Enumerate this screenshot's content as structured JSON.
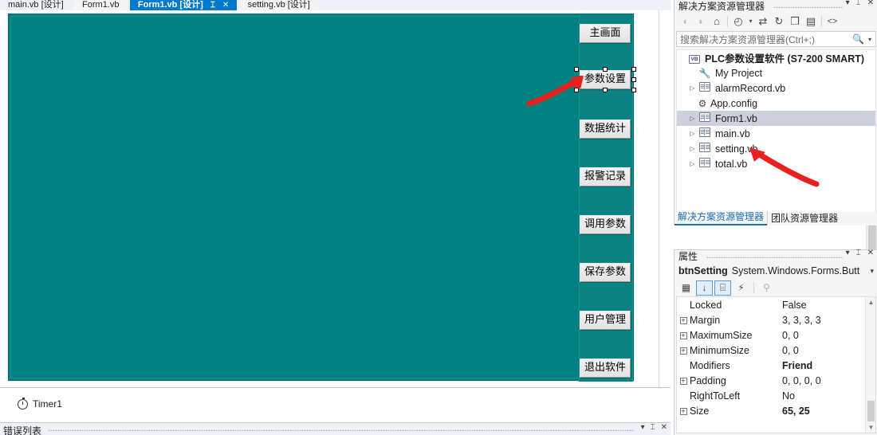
{
  "editor_tabs": [
    {
      "label": "main.vb [设计]",
      "state": "inactive"
    },
    {
      "label": "Form1.vb",
      "state": "inactive"
    },
    {
      "label": "Form1.vb [设计]",
      "state": "active"
    },
    {
      "label": "setting.vb [设计]",
      "state": "inactive"
    }
  ],
  "designer": {
    "form_background": "#008080",
    "panel_background": "#0b8382",
    "buttons": [
      {
        "label": "主画面",
        "selected": false
      },
      {
        "label": "参数设置",
        "selected": true
      },
      {
        "label": "数据统计",
        "selected": false
      },
      {
        "label": "报警记录",
        "selected": false
      },
      {
        "label": "调用参数",
        "selected": false
      },
      {
        "label": "保存参数",
        "selected": false
      },
      {
        "label": "用户管理",
        "selected": false
      },
      {
        "label": "退出软件",
        "selected": false
      }
    ]
  },
  "component_tray": {
    "items": [
      {
        "label": "Timer1",
        "icon": "timer-icon"
      }
    ]
  },
  "error_list": {
    "title": "错误列表",
    "controls": [
      "▾",
      "⌶",
      "✕"
    ]
  },
  "solution_explorer": {
    "title": "解决方案资源管理器",
    "header_controls": [
      "▾",
      "⌶",
      "✕"
    ],
    "toolbar": [
      {
        "name": "back-icon",
        "glyph": "◖",
        "disabled": true
      },
      {
        "name": "forward-icon",
        "glyph": "◗",
        "disabled": true
      },
      {
        "name": "home-icon",
        "glyph": "⌂",
        "disabled": false
      },
      {
        "name": "pending-changes-icon",
        "glyph": "◴",
        "disabled": false
      },
      {
        "name": "pending-changes-dropdown-icon",
        "glyph": "▾",
        "disabled": false
      },
      {
        "name": "sync-with-active-document-icon",
        "glyph": "⇄",
        "disabled": false
      },
      {
        "name": "refresh-icon",
        "glyph": "↻",
        "disabled": false
      },
      {
        "name": "collapse-all-icon",
        "glyph": "❒",
        "disabled": false
      },
      {
        "name": "properties-icon",
        "glyph": "▤",
        "disabled": false
      },
      {
        "name": "show-all-files-icon",
        "glyph": "<>",
        "disabled": false
      }
    ],
    "search_placeholder": "搜索解决方案资源管理器(Ctrl+;)",
    "tree": [
      {
        "label": "PLC参数设置软件  (S7-200 SMART)",
        "icon": "vb-project-icon",
        "indent": 0,
        "expander": "",
        "bold": true,
        "selected": false
      },
      {
        "label": "My Project",
        "icon": "wrench-icon",
        "indent": 1,
        "expander": "",
        "bold": false,
        "selected": false
      },
      {
        "label": "alarmRecord.vb",
        "icon": "vb-form-icon",
        "indent": 1,
        "expander": "▷",
        "bold": false,
        "selected": false
      },
      {
        "label": "App.config",
        "icon": "config-icon",
        "indent": 1,
        "expander": "",
        "bold": false,
        "selected": false
      },
      {
        "label": "Form1.vb",
        "icon": "vb-form-icon",
        "indent": 1,
        "expander": "▷",
        "bold": false,
        "selected": true
      },
      {
        "label": "main.vb",
        "icon": "vb-form-icon",
        "indent": 1,
        "expander": "▷",
        "bold": false,
        "selected": false
      },
      {
        "label": "setting.vb",
        "icon": "vb-form-icon",
        "indent": 1,
        "expander": "▷",
        "bold": false,
        "selected": false
      },
      {
        "label": "total.vb",
        "icon": "vb-form-icon",
        "indent": 1,
        "expander": "▷",
        "bold": false,
        "selected": false
      }
    ],
    "bottom_tabs": [
      {
        "label": "解决方案资源管理器",
        "active": true
      },
      {
        "label": "团队资源管理器",
        "active": false
      }
    ]
  },
  "properties": {
    "title": "属性",
    "header_controls": [
      "▾",
      "⌶",
      "✕"
    ],
    "object_name": "btnSetting",
    "object_type": "System.Windows.Forms.Butt",
    "object_caret": "▾",
    "toolbar": [
      {
        "name": "categorized-icon",
        "glyph": "▦",
        "active": false,
        "disabled": false
      },
      {
        "name": "alphabetical-icon",
        "glyph": "↓",
        "active": true,
        "disabled": false
      },
      {
        "name": "properties-icon",
        "glyph": "⌸",
        "active": true,
        "disabled": false
      },
      {
        "name": "events-icon",
        "glyph": "⚡",
        "active": false,
        "disabled": false
      },
      {
        "name": "property-pages-icon",
        "glyph": "⚲",
        "active": false,
        "disabled": true
      }
    ],
    "rows": [
      {
        "expander": "",
        "name": "Locked",
        "value": "False",
        "bold": false
      },
      {
        "expander": "+",
        "name": "Margin",
        "value": "3, 3, 3, 3",
        "bold": false
      },
      {
        "expander": "+",
        "name": "MaximumSize",
        "value": "0, 0",
        "bold": false
      },
      {
        "expander": "+",
        "name": "MinimumSize",
        "value": "0, 0",
        "bold": false
      },
      {
        "expander": "",
        "name": "Modifiers",
        "value": "Friend",
        "bold": true
      },
      {
        "expander": "+",
        "name": "Padding",
        "value": "0, 0, 0, 0",
        "bold": false
      },
      {
        "expander": "",
        "name": "RightToLeft",
        "value": "No",
        "bold": false
      },
      {
        "expander": "+",
        "name": "Size",
        "value": "65, 25",
        "bold": true
      }
    ]
  },
  "annotations": {
    "accent_color": "#e8201e",
    "arrows": [
      {
        "name": "arrow-to-parameter-settings-button",
        "points_at": "参数设置"
      },
      {
        "name": "arrow-to-setting-vb-node",
        "points_at": "setting.vb"
      }
    ]
  }
}
